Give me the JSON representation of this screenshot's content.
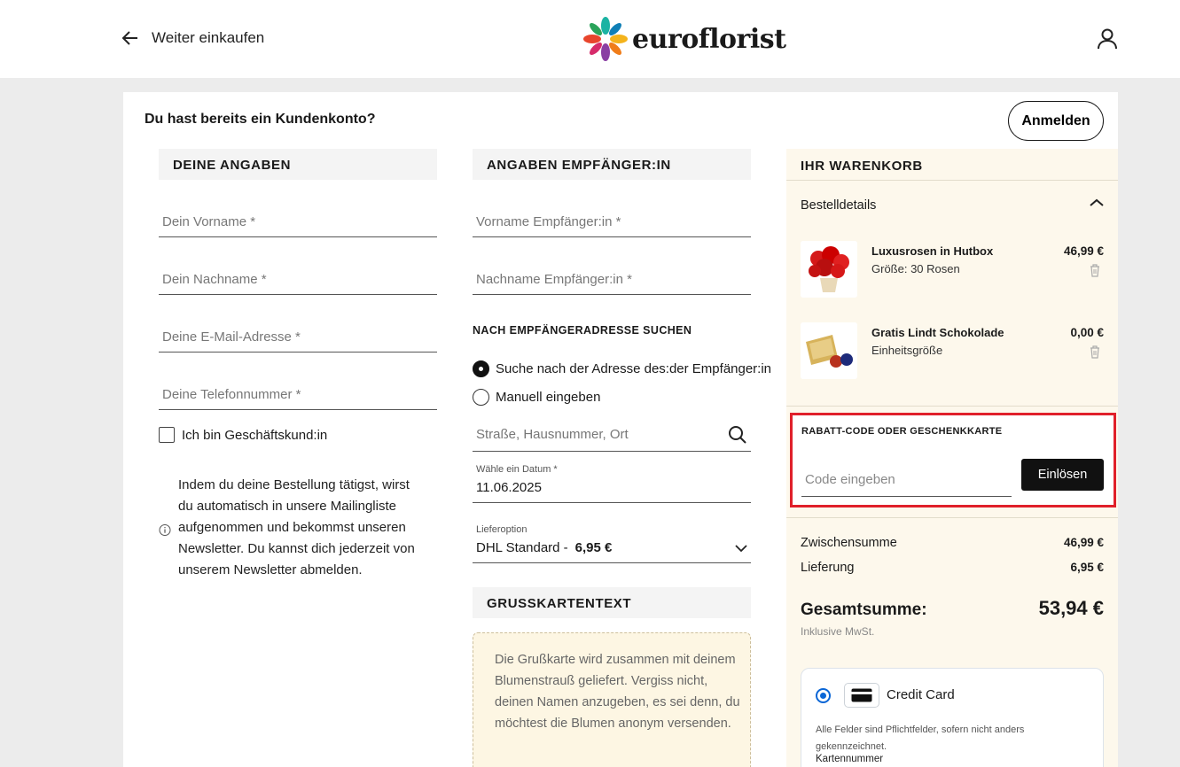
{
  "header": {
    "back_label": "Weiter einkaufen",
    "logo_text": "euroflorist"
  },
  "account": {
    "question": "Du hast bereits ein Kundenkonto?",
    "login_label": "Anmelden"
  },
  "your_details": {
    "heading": "DEINE ANGABEN",
    "first_name_placeholder": "Dein Vorname *",
    "last_name_placeholder": "Dein Nachname *",
    "email_placeholder": "Deine E-Mail-Adresse *",
    "phone_placeholder": "Deine Telefonnummer *",
    "business_checkbox_label": "Ich bin Geschäftskund:in",
    "newsletter_info": "Indem du deine Bestellung tätigst, wirst du automatisch in unsere Mailingliste aufgenommen und bekommst unseren Newsletter. Du kannst dich jederzeit von unserem Newsletter abmelden."
  },
  "recipient": {
    "heading": "ANGABEN EMPFÄNGER:IN",
    "first_name_placeholder": "Vorname Empfänger:in *",
    "last_name_placeholder": "Nachname Empfänger:in *",
    "address_search_heading": "NACH EMPFÄNGERADRESSE SUCHEN",
    "radio_search_label": "Suche nach der Adresse des:der Empfänger:in",
    "radio_manual_label": "Manuell eingeben",
    "address_placeholder": "Straße, Hausnummer, Ort",
    "date_label": "Wähle ein Datum *",
    "date_value": "11.06.2025",
    "delivery_label": "Lieferoption",
    "delivery_value": "DHL Standard -",
    "delivery_price": "6,95 €"
  },
  "greeting_card": {
    "heading": "GRUSSKARTENTEXT",
    "placeholder": "Die Grußkarte wird zusammen mit deinem Blumenstrauß geliefert. Vergiss nicht, deinen Namen anzugeben, es sei denn, du möchtest die Blumen anonym versenden."
  },
  "cart": {
    "heading": "IHR WARENKORB",
    "details_label": "Bestelldetails",
    "items": [
      {
        "name": "Luxusrosen in Hutbox",
        "desc": "Größe: 30 Rosen",
        "price": "46,99 €"
      },
      {
        "name": "Gratis Lindt Schokolade",
        "desc": "Einheitsgröße",
        "price": "0,00 €"
      }
    ],
    "promo": {
      "heading": "RABATT-CODE ODER GESCHENKKARTE",
      "placeholder": "Code eingeben",
      "redeem_label": "Einlösen"
    },
    "subtotal_label": "Zwischensumme",
    "subtotal_value": "46,99 €",
    "delivery_label": "Lieferung",
    "delivery_value": "6,95 €",
    "total_label": "Gesamtsumme:",
    "total_value": "53,94 €",
    "tax_note": "Inklusive MwSt."
  },
  "payment": {
    "method_label": "Credit Card",
    "note": "Alle Felder sind Pflichtfelder, sofern nicht anders gekennzeichnet.",
    "card_number_label": "Kartennummer",
    "accent_color": "#0a66d6"
  },
  "colors": {
    "highlight_border": "#e0202a",
    "cart_background": "#fdf8ec",
    "page_background": "#ececec"
  },
  "icons": [
    "arrow-left-icon",
    "user-icon",
    "search-icon",
    "chevron-up-icon",
    "chevron-down-icon",
    "trash-icon",
    "info-icon",
    "credit-card-icon"
  ]
}
